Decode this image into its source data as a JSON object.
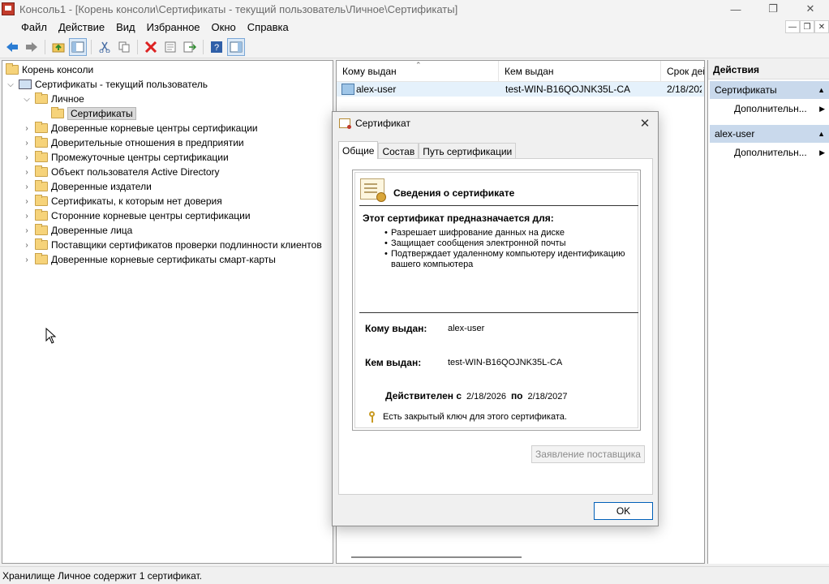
{
  "window": {
    "title": "Консоль1 - [Корень консоли\\Сертификаты - текущий пользователь\\Личное\\Сертификаты]",
    "minimize": "—",
    "maximize": "❐",
    "close": "✕"
  },
  "menu": [
    "Файл",
    "Действие",
    "Вид",
    "Избранное",
    "Окно",
    "Справка"
  ],
  "mdi_controls": [
    "—",
    "❐",
    "✕"
  ],
  "toolbar_icons": [
    "back-arrow-icon",
    "forward-arrow-icon",
    "up-folder-icon",
    "show-hide-tree-icon",
    "cut-icon",
    "copy-icon",
    "delete-icon",
    "properties-icon",
    "export-icon",
    "help-icon",
    "show-hide-action-pane-icon"
  ],
  "tree": {
    "root": "Корень консоли",
    "current_user": "Сертификаты - текущий пользователь",
    "personal": "Личное",
    "certificates": "Сертификаты",
    "stores": [
      "Доверенные корневые центры сертификации",
      "Доверительные отношения в предприятии",
      "Промежуточные центры сертификации",
      "Объект пользователя Active Directory",
      "Доверенные издатели",
      "Сертификаты, к которым нет доверия",
      "Сторонние корневые центры сертификации",
      "Доверенные лица",
      "Поставщики сертификатов проверки подлинности клиентов",
      "Доверенные корневые сертификаты смарт-карты"
    ]
  },
  "list": {
    "columns": [
      "Кому выдан",
      "Кем выдан",
      "Срок дей"
    ],
    "rows": [
      {
        "issued_to": "alex-user",
        "issued_by": "test-WIN-B16QOJNK35L-CA",
        "expires": "2/18/202"
      }
    ]
  },
  "actions": {
    "title": "Действия",
    "section1": "Сертификаты",
    "section1_item": "Дополнительн...",
    "section2": "alex-user",
    "section2_item": "Дополнительн..."
  },
  "status": "Хранилище Личное содержит 1 сертификат.",
  "dialog": {
    "title": "Сертификат",
    "tabs": [
      "Общие",
      "Состав",
      "Путь сертификации"
    ],
    "info_title": "Сведения о сертификате",
    "purpose_heading": "Этот сертификат предназначается для:",
    "purposes": [
      "Разрешает шифрование данных на диске",
      "Защищает сообщения электронной почты",
      "Подтверждает удаленному компьютеру идентификацию вашего компьютера"
    ],
    "issued_to_label": "Кому выдан:",
    "issued_to": "alex-user",
    "issued_by_label": "Кем выдан:",
    "issued_by": "test-WIN-B16QOJNK35L-CA",
    "valid_from_label": "Действителен с",
    "valid_from": "2/18/2026",
    "valid_to_label": "по",
    "valid_to": "2/18/2027",
    "private_key_note": "Есть закрытый ключ для этого сертификата.",
    "issuer_statement_button": "Заявление поставщика",
    "ok_button": "OK"
  }
}
